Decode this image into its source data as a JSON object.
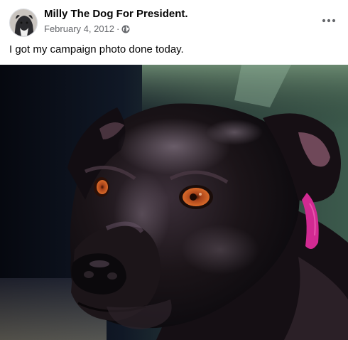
{
  "post": {
    "author_name": "Milly The Dog For President.",
    "date": "February 4, 2012",
    "separator": "·",
    "privacy_icon": "globe-icon",
    "more_icon": "more-options-icon",
    "caption": "I got my campaign photo done today.",
    "photo_subject": "black dog with orange eyes and pink collar"
  },
  "colors": {
    "meta_text": "#65676b",
    "author_text": "#050505",
    "collar": "#d22a92",
    "eye": "#c2541d"
  }
}
